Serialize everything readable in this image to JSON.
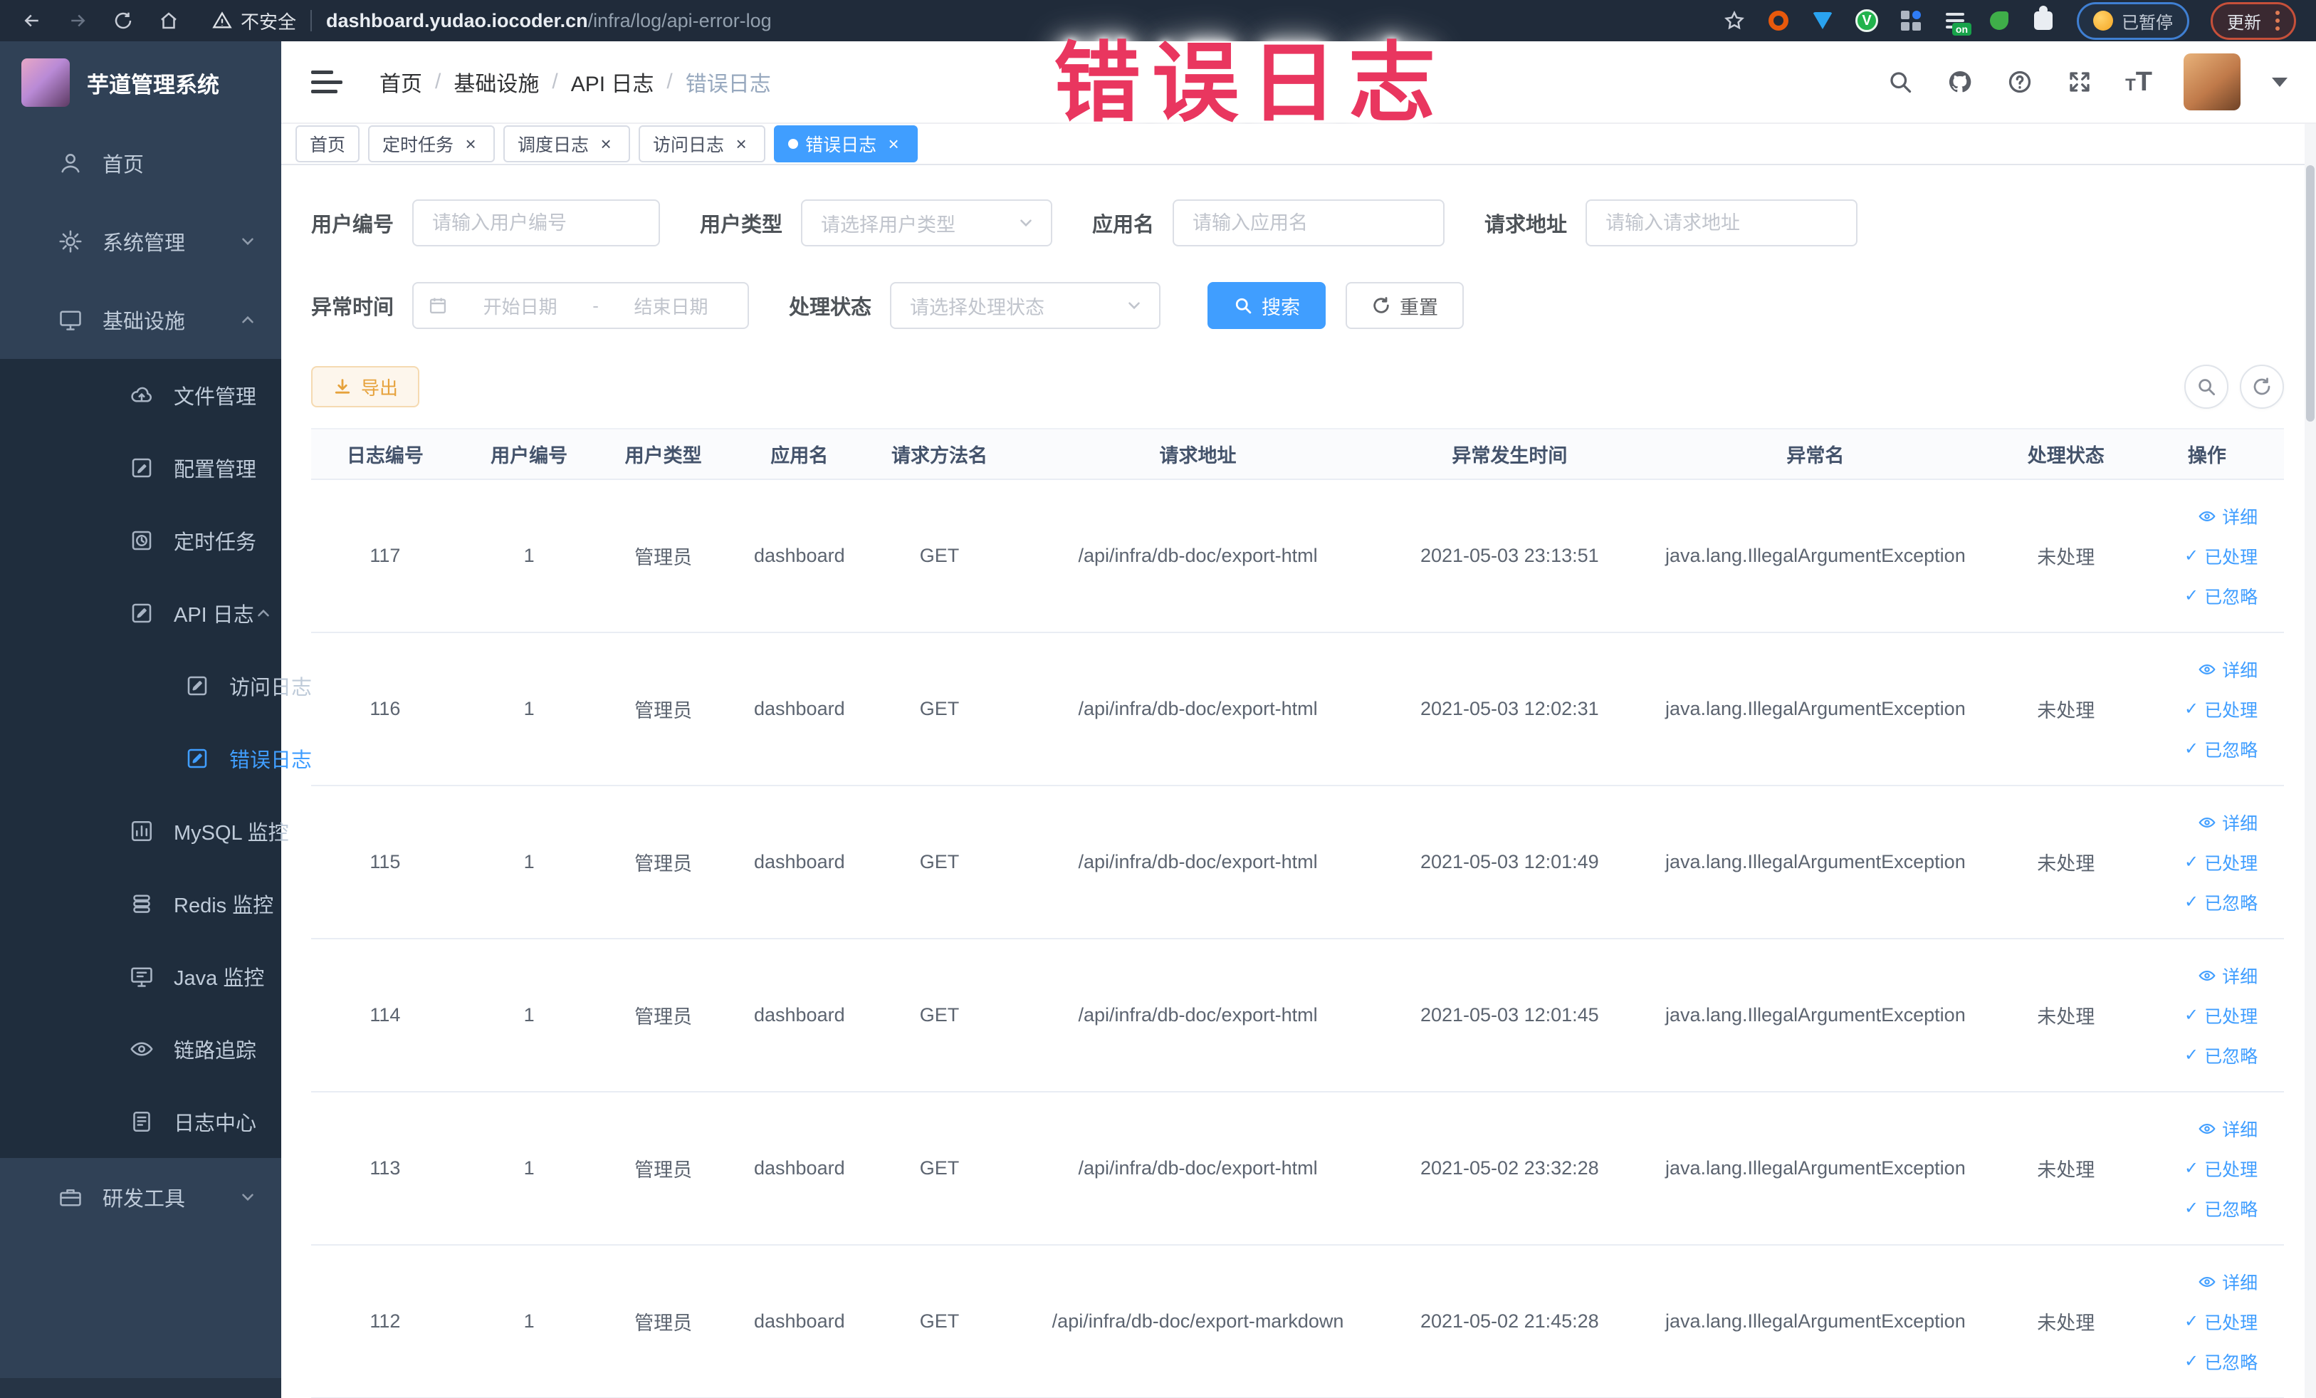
{
  "browser": {
    "security_text": "不安全",
    "url_domain": "dashboard.yudao.iocoder.cn",
    "url_path": "/infra/log/api-error-log",
    "paused_badge": "已暂停",
    "update_badge": "更新",
    "on_badge": "on"
  },
  "overlay": {
    "text": "错误日志",
    "color": "#e9365f"
  },
  "sidebar": {
    "app_title": "芋道管理系统",
    "items": [
      {
        "label": "首页",
        "icon": "user-icon",
        "level": "top"
      },
      {
        "label": "系统管理",
        "icon": "gear-icon",
        "level": "top",
        "has_chevron": true
      },
      {
        "label": "基础设施",
        "icon": "monitor-icon",
        "level": "top",
        "has_chevron": true,
        "chevron_up": true
      },
      {
        "label": "文件管理",
        "icon": "cloud-upload-icon",
        "level": "sub"
      },
      {
        "label": "配置管理",
        "icon": "edit-icon",
        "level": "sub"
      },
      {
        "label": "定时任务",
        "icon": "clock-icon",
        "level": "sub"
      },
      {
        "label": "API 日志",
        "icon": "edit-square-icon",
        "level": "sub",
        "has_chevron": true,
        "chevron_up": true
      },
      {
        "label": "访问日志",
        "icon": "edit-square-icon",
        "level": "subsub"
      },
      {
        "label": "错误日志",
        "icon": "edit-square-icon",
        "level": "subsub",
        "active": true
      },
      {
        "label": "MySQL 监控",
        "icon": "chart-icon",
        "level": "sub"
      },
      {
        "label": "Redis 监控",
        "icon": "db-icon",
        "level": "sub"
      },
      {
        "label": "Java 监控",
        "icon": "java-monitor-icon",
        "level": "sub"
      },
      {
        "label": "链路追踪",
        "icon": "eye-icon",
        "level": "sub"
      },
      {
        "label": "日志中心",
        "icon": "doc-edit-icon",
        "level": "sub"
      },
      {
        "label": "研发工具",
        "icon": "toolbox-icon",
        "level": "top",
        "has_chevron": true
      }
    ]
  },
  "breadcrumb": {
    "separator": "/",
    "items": [
      "首页",
      "基础设施",
      "API 日志",
      "错误日志"
    ]
  },
  "tabs": [
    {
      "label": "首页"
    },
    {
      "label": "定时任务",
      "closable": true
    },
    {
      "label": "调度日志",
      "closable": true
    },
    {
      "label": "访问日志",
      "closable": true
    },
    {
      "label": "错误日志",
      "closable": true,
      "active": true
    }
  ],
  "filters": {
    "user_id": {
      "label": "用户编号",
      "placeholder": "请输入用户编号"
    },
    "user_type": {
      "label": "用户类型",
      "placeholder": "请选择用户类型"
    },
    "app_name": {
      "label": "应用名",
      "placeholder": "请输入应用名"
    },
    "request_url": {
      "label": "请求地址",
      "placeholder": "请输入请求地址"
    },
    "exception_time": {
      "label": "异常时间",
      "start_placeholder": "开始日期",
      "separator": "-",
      "end_placeholder": "结束日期"
    },
    "process_status": {
      "label": "处理状态",
      "placeholder": "请选择处理状态"
    },
    "search_label": "搜索",
    "reset_label": "重置"
  },
  "toolbar": {
    "export_label": "导出"
  },
  "table": {
    "columns": [
      "日志编号",
      "用户编号",
      "用户类型",
      "应用名",
      "请求方法名",
      "请求地址",
      "异常发生时间",
      "异常名",
      "处理状态",
      "操作"
    ],
    "actions": [
      "详细",
      "已处理",
      "已忽略"
    ],
    "rows": [
      {
        "id": "117",
        "user_id": "1",
        "user_type": "管理员",
        "app": "dashboard",
        "method": "GET",
        "url": "/api/infra/db-doc/export-html",
        "time": "2021-05-03 23:13:51",
        "exception": "java.lang.IllegalArgumentException",
        "status": "未处理"
      },
      {
        "id": "116",
        "user_id": "1",
        "user_type": "管理员",
        "app": "dashboard",
        "method": "GET",
        "url": "/api/infra/db-doc/export-html",
        "time": "2021-05-03 12:02:31",
        "exception": "java.lang.IllegalArgumentException",
        "status": "未处理"
      },
      {
        "id": "115",
        "user_id": "1",
        "user_type": "管理员",
        "app": "dashboard",
        "method": "GET",
        "url": "/api/infra/db-doc/export-html",
        "time": "2021-05-03 12:01:49",
        "exception": "java.lang.IllegalArgumentException",
        "status": "未处理"
      },
      {
        "id": "114",
        "user_id": "1",
        "user_type": "管理员",
        "app": "dashboard",
        "method": "GET",
        "url": "/api/infra/db-doc/export-html",
        "time": "2021-05-03 12:01:45",
        "exception": "java.lang.IllegalArgumentException",
        "status": "未处理"
      },
      {
        "id": "113",
        "user_id": "1",
        "user_type": "管理员",
        "app": "dashboard",
        "method": "GET",
        "url": "/api/infra/db-doc/export-html",
        "time": "2021-05-02 23:32:28",
        "exception": "java.lang.IllegalArgumentException",
        "status": "未处理"
      },
      {
        "id": "112",
        "user_id": "1",
        "user_type": "管理员",
        "app": "dashboard",
        "method": "GET",
        "url": "/api/infra/db-doc/export-markdown",
        "time": "2021-05-02 21:45:28",
        "exception": "java.lang.IllegalArgumentException",
        "status": "未处理"
      }
    ]
  }
}
